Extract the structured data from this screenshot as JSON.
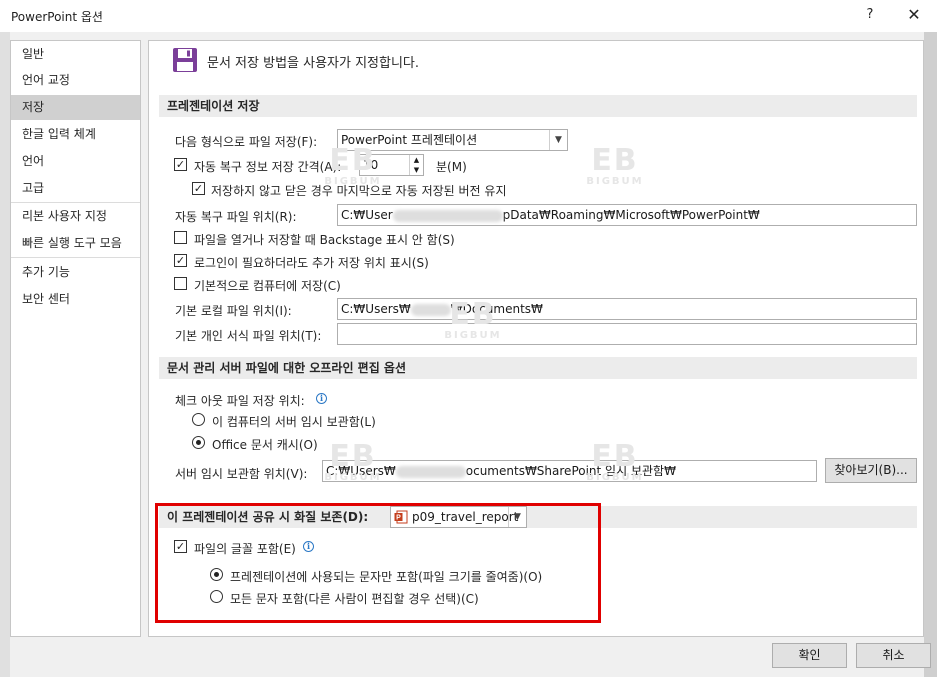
{
  "window": {
    "title": "PowerPoint 옵션",
    "help_label": "?",
    "close_label": "✕"
  },
  "sidebar": {
    "items": [
      {
        "label": "일반"
      },
      {
        "label": "언어 교정"
      },
      {
        "label": "저장",
        "active": true
      },
      {
        "label": "한글 입력 체계"
      },
      {
        "label": "언어"
      },
      {
        "label": "고급"
      },
      {
        "label": "리본 사용자 지정"
      },
      {
        "label": "빠른 실행 도구 모음"
      },
      {
        "label": "추가 기능"
      },
      {
        "label": "보안 센터"
      }
    ]
  },
  "header": {
    "icon": "floppy-disk-icon",
    "icon_color": "#7b3f99",
    "title": "문서 저장 방법을 사용자가 지정합니다."
  },
  "save_section": {
    "title": "프레젠테이션 저장",
    "format_label": "다음 형식으로 파일 저장(F):",
    "format_value": "PowerPoint 프레젠테이션",
    "autorecover_label": "자동 복구 정보 저장 간격(A):",
    "autorecover_checked": true,
    "autorecover_minutes": "10",
    "minutes_label": "분(M)",
    "keep_last_label": "저장하지 않고 닫은 경우 마지막으로 자동 저장된 버전 유지",
    "keep_last_checked": true,
    "autorecover_location_label": "자동 복구 파일 위치(R):",
    "autorecover_location_prefix": "C:₩User",
    "autorecover_location_suffix": "pData₩Roaming₩Microsoft₩PowerPoint₩",
    "backstage_label": "파일을 열거나 저장할 때 Backstage 표시 안 함(S)",
    "backstage_checked": false,
    "additional_places_label": "로그인이 필요하더라도 추가 저장 위치 표시(S)",
    "additional_places_checked": true,
    "save_to_computer_label": "기본적으로 컴퓨터에 저장(C)",
    "save_to_computer_checked": false,
    "default_local_label": "기본 로컬 파일 위치(I):",
    "default_local_prefix": "C:₩Users₩",
    "default_local_suffix": "₩Documents₩",
    "template_location_label": "기본 개인 서식 파일 위치(T):",
    "template_location_value": ""
  },
  "offline_section": {
    "title": "문서 관리 서버 파일에 대한 오프라인 편집 옵션",
    "checkout_label": "체크 아웃 파일 저장 위치:",
    "options": [
      {
        "label": "이 컴퓨터의 서버 임시 보관함(L)",
        "selected": false
      },
      {
        "label": "Office 문서 캐시(O)",
        "selected": true
      }
    ],
    "drafts_label": "서버 임시 보관함 위치(V):",
    "drafts_prefix": "C:₩Users₩",
    "drafts_suffix": "ocuments₩SharePoint 임시 보관함₩",
    "browse_label": "찾아보기(B)..."
  },
  "fidelity_section": {
    "title": "이 프레젠테이션 공유 시 화질 보존(D):",
    "presentation_name": "p09_travel_report",
    "embed_fonts_label": "파일의 글꼴 포함(E)",
    "embed_fonts_checked": true,
    "embed_options": [
      {
        "label": "프레젠테이션에 사용되는 문자만 포함(파일 크기를 줄여줌)(O)",
        "selected": true
      },
      {
        "label": "모든 문자 포함(다른 사람이 편집할 경우 선택)(C)",
        "selected": false
      }
    ]
  },
  "watermark": {
    "big": "EB",
    "small": "BIGBUM"
  },
  "footer": {
    "ok_label": "확인",
    "cancel_label": "취소"
  },
  "highlight_color": "#e00000"
}
